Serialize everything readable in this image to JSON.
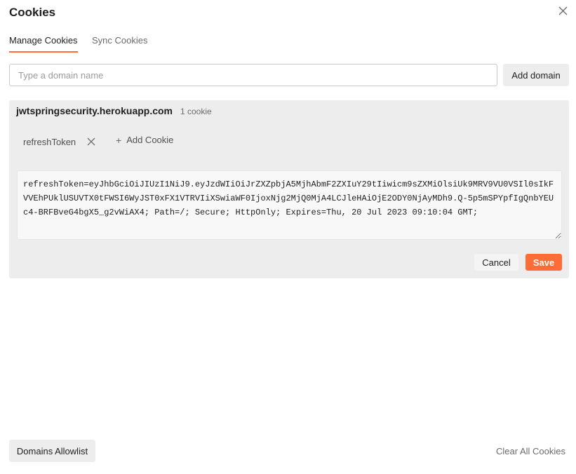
{
  "modal": {
    "title": "Cookies",
    "close_icon": "close-icon"
  },
  "tabs": [
    {
      "label": "Manage Cookies",
      "active": true
    },
    {
      "label": "Sync Cookies",
      "active": false
    }
  ],
  "domain_input": {
    "placeholder": "Type a domain name",
    "value": ""
  },
  "add_domain_label": "Add domain",
  "domain_entry": {
    "name": "jwtspringsecurity.herokuapp.com",
    "count_label": "1 cookie",
    "cookies": [
      {
        "name": "refreshToken",
        "remove_icon": "close-icon"
      }
    ],
    "add_cookie_label": "Add Cookie",
    "add_cookie_icon": "plus-icon",
    "editor_value": "refreshToken=eyJhbGciOiJIUzI1NiJ9.eyJzdWIiOiJrZXZpbjA5MjhAbmF2ZXIuY29tIiwicm9sZXMiOlsiUk9MRV9VU0VSIl0sIkFVVEhPUklUSUVTX0tFWSI6WyJST0xFX1VTRVIiXSwiaWF0IjoxNjg2MjQ0MjA4LCJleHAiOjE2ODY0NjAyMDh9.Q-5p5mSPYpfIgQnbYEUc4-BRFBveG4bgX5_g2vWiAX4; Path=/; Secure; HttpOnly; Expires=Thu, 20 Jul 2023 09:10:04 GMT;",
    "cancel_label": "Cancel",
    "save_label": "Save"
  },
  "footer": {
    "allowlist_label": "Domains Allowlist",
    "clear_all_label": "Clear All Cookies"
  },
  "colors": {
    "accent": "#ff6c37",
    "panel_bg": "#ededed",
    "muted_text": "#6b6b6b"
  }
}
